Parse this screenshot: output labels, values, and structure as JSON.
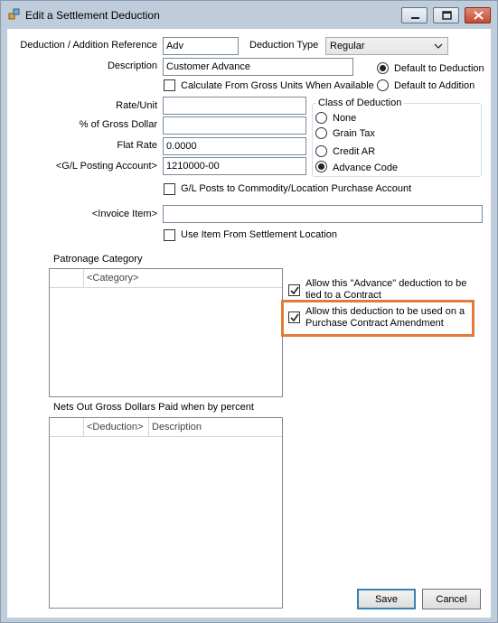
{
  "window": {
    "title": "Edit a Settlement Deduction",
    "accent": "#e07b39"
  },
  "form": {
    "deduction_ref_label": "Deduction / Addition Reference",
    "deduction_ref_value": "Adv",
    "deduction_type_label": "Deduction Type",
    "deduction_type_value": "Regular",
    "description_label": "Description",
    "description_value": "Customer Advance",
    "default_to_deduction": "Default to Deduction",
    "default_to_addition": "Default to Addition",
    "calc_gross_units": "Calculate From Gross Units When Available",
    "rate_unit_label": "Rate/Unit",
    "rate_unit_value": "",
    "pct_gross_label": "% of Gross Dollar",
    "pct_gross_value": "",
    "flat_rate_label": "Flat Rate",
    "flat_rate_value": "0.0000",
    "gl_posting_label": "<G/L Posting Account>",
    "gl_posting_value": "1210000-00",
    "gl_posts_commodity": "G/L Posts to Commodity/Location Purchase Account",
    "invoice_item_label": "<Invoice Item>",
    "invoice_item_value": "",
    "use_item_settlement": "Use Item From Settlement Location"
  },
  "class_of_deduction": {
    "title": "Class of Deduction",
    "options": [
      "None",
      "Grain Tax",
      "Credit AR",
      "Advance Code"
    ],
    "selected": "Advance Code"
  },
  "patronage": {
    "title": "Patronage Category",
    "column": "<Category>"
  },
  "options": {
    "allow_advance_tied": "Allow this \"Advance\" deduction to be tied to a Contract",
    "allow_purchase_amendment": "Allow this deduction to be used on a Purchase Contract Amendment"
  },
  "nets_out": {
    "title": "Nets Out Gross Dollars Paid when by percent",
    "col_deduction": "<Deduction>",
    "col_description": "Description"
  },
  "buttons": {
    "save": "Save",
    "cancel": "Cancel"
  }
}
